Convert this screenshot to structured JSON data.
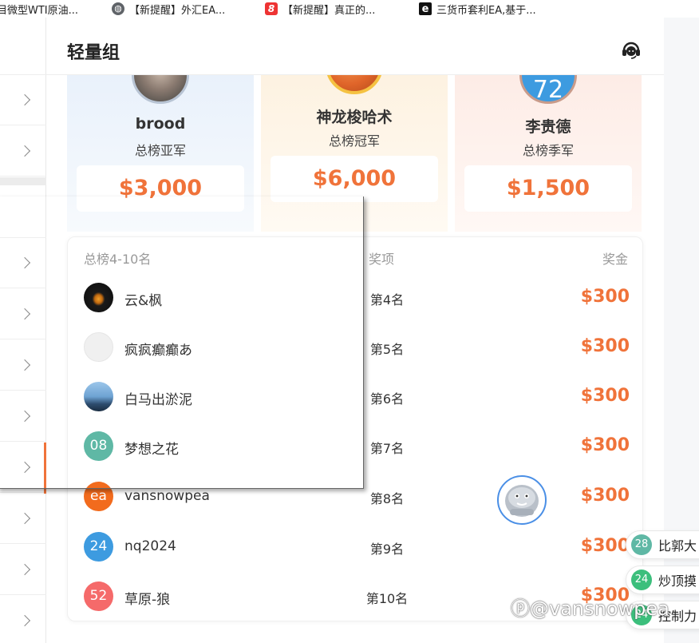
{
  "bookmarks": [
    {
      "label": "目微型WTI原油...",
      "icon": "none"
    },
    {
      "label": "【新提醒】外汇EA...",
      "icon": "globe-icon"
    },
    {
      "label": "【新提醒】真正的...",
      "icon": "red-8-icon"
    },
    {
      "label": "三货币套利EA,基于...",
      "icon": "e-icon"
    }
  ],
  "header": {
    "title": "轻量组",
    "support_icon": "headset-icon"
  },
  "podium": {
    "second": {
      "name": "brood",
      "rank": "总榜亚军",
      "prize": "$3,000"
    },
    "first": {
      "name": "神龙梭哈术",
      "rank": "总榜冠军",
      "prize": "$6,000"
    },
    "third": {
      "name": "李贵德",
      "rank": "总榜季军",
      "prize": "$1,500",
      "avatar_text": "72"
    }
  },
  "list": {
    "col_rank": "总榜4-10名",
    "col_award": "奖项",
    "col_prize": "奖金",
    "rows": [
      {
        "name": "云&枫",
        "award": "第4名",
        "prize": "$300",
        "avatar_text": "",
        "avatar_color": "#1a1a1a"
      },
      {
        "name": "疯疯癫癫あ",
        "award": "第5名",
        "prize": "$300",
        "avatar_text": "",
        "avatar_color": "#eeeeee"
      },
      {
        "name": "白马出淤泥",
        "award": "第6名",
        "prize": "$300",
        "avatar_text": "",
        "avatar_color": "#5b8fc4"
      },
      {
        "name": "梦想之花",
        "award": "第7名",
        "prize": "$300",
        "avatar_text": "08",
        "avatar_color": "#5fb8a5"
      },
      {
        "name": "vansnowpea",
        "award": "第8名",
        "prize": "$300",
        "avatar_text": "ea",
        "avatar_color": "#f26b1d"
      },
      {
        "name": "nq2024",
        "award": "第9名",
        "prize": "$300",
        "avatar_text": "24",
        "avatar_color": "#3d9be0"
      },
      {
        "name": "草原-狼",
        "award": "第10名",
        "prize": "$300",
        "avatar_text": "52",
        "avatar_color": "#f56a6a"
      }
    ]
  },
  "chips": [
    {
      "avatar_text": "28",
      "label": "比郭大",
      "color": "#5fb8a5"
    },
    {
      "avatar_text": "24",
      "label": "炒顶摸",
      "color": "#3cbf7c"
    },
    {
      "avatar_text": "24",
      "label": "控制力",
      "color": "#3cbf7c"
    }
  ],
  "watermark": "@vansnowpea",
  "colors": {
    "accent": "#f0733a",
    "gold_ring": "#f5c242"
  }
}
